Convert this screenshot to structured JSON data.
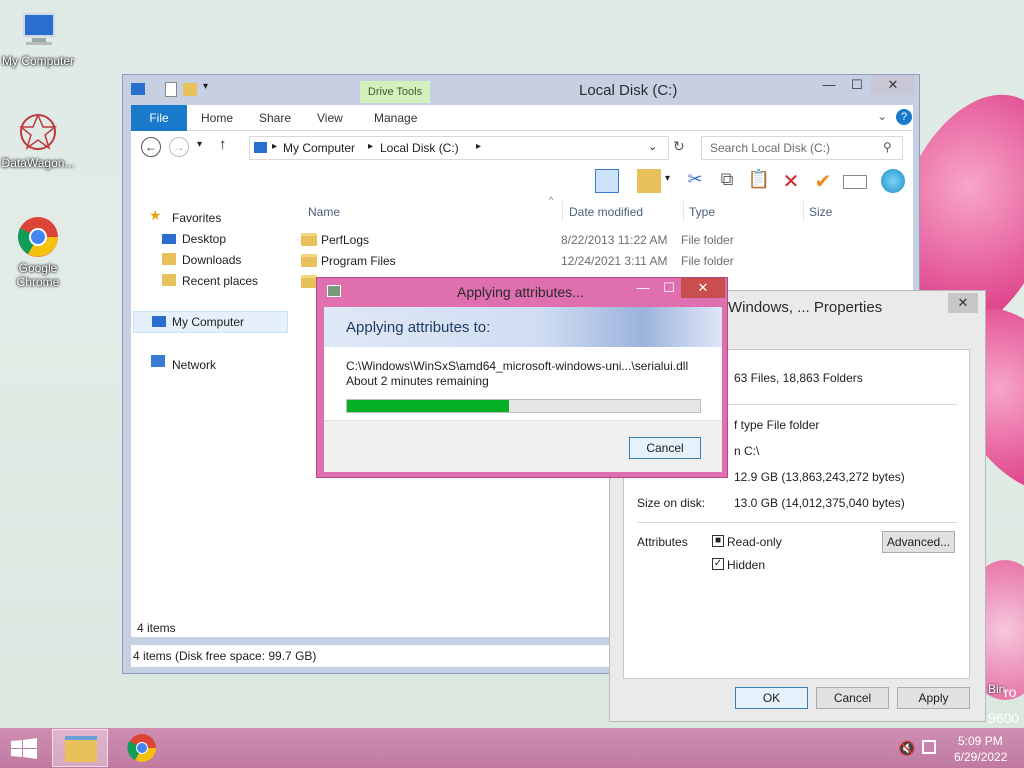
{
  "desktop": {
    "icons": [
      {
        "label": "My Computer"
      },
      {
        "label": "DataWagon..."
      },
      {
        "label": "Google Chrome"
      }
    ],
    "recycle_bin_label": "Bin",
    "watermark": "ro",
    "build": "9600"
  },
  "explorer": {
    "title": "Local Disk (C:)",
    "contextual_tab": "Drive Tools",
    "tabs": [
      "File",
      "Home",
      "Share",
      "View",
      "Manage"
    ],
    "breadcrumb": [
      "My Computer",
      "Local Disk (C:)"
    ],
    "search_placeholder": "Search Local Disk (C:)",
    "nav": {
      "favorites": "Favorites",
      "desktop": "Desktop",
      "downloads": "Downloads",
      "recent": "Recent places",
      "computer": "My Computer",
      "network": "Network"
    },
    "columns": [
      "Name",
      "Date modified",
      "Type",
      "Size"
    ],
    "rows": [
      {
        "name": "PerfLogs",
        "date": "8/22/2013 11:22 AM",
        "type": "File folder"
      },
      {
        "name": "Program Files",
        "date": "12/24/2021 3:11 AM",
        "type": "File folder"
      }
    ],
    "item_count": "4 items",
    "status": "4 items (Disk free space: 99.7 GB)"
  },
  "properties": {
    "title": "Windows, ... Properties",
    "contains": "63 Files, 18,863 Folders",
    "type": "f type File folder",
    "location": "n C:\\",
    "size_value": "12.9 GB (13,863,243,272 bytes)",
    "size_on_disk_label": "Size on disk:",
    "size_on_disk": "13.0 GB (14,012,375,040 bytes)",
    "attributes_label": "Attributes",
    "readonly_label": "Read-only",
    "hidden_label": "Hidden",
    "advanced_label": "Advanced...",
    "ok_label": "OK",
    "cancel_label": "Cancel",
    "apply_label": "Apply"
  },
  "dialog": {
    "title": "Applying attributes...",
    "heading": "Applying attributes to:",
    "path": "C:\\Windows\\WinSxS\\amd64_microsoft-windows-uni...\\serialui.dll",
    "remaining": "About 2 minutes remaining",
    "progress": 0.46,
    "cancel_label": "Cancel"
  },
  "taskbar": {
    "time": "5:09 PM",
    "date": "6/29/2022"
  },
  "colors": {
    "accent": "#1979ca",
    "progress": "#06b025",
    "dialog_frame": "#df6fae",
    "taskbar": "#c781a8"
  }
}
